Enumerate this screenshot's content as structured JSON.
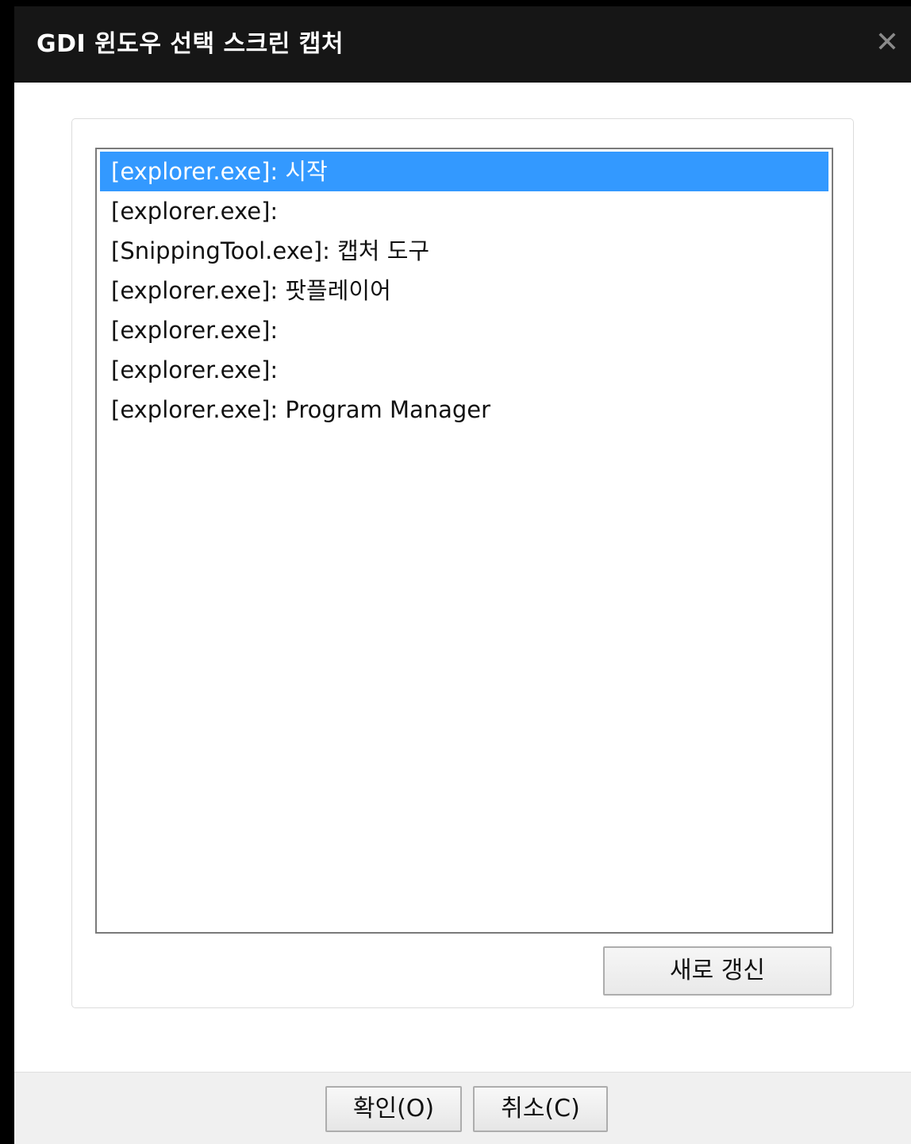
{
  "window": {
    "title": "GDI 윈도우 선택 스크린 캡처",
    "close_symbol": "✕"
  },
  "window_list": {
    "items": [
      {
        "label": "[explorer.exe]: 시작",
        "selected": true
      },
      {
        "label": "[explorer.exe]:",
        "selected": false
      },
      {
        "label": "[SnippingTool.exe]: 캡처 도구",
        "selected": false
      },
      {
        "label": "[explorer.exe]: 팟플레이어",
        "selected": false
      },
      {
        "label": "[explorer.exe]:",
        "selected": false
      },
      {
        "label": "[explorer.exe]:",
        "selected": false
      },
      {
        "label": "[explorer.exe]: Program Manager",
        "selected": false
      }
    ]
  },
  "buttons": {
    "refresh": "새로 갱신",
    "ok": "확인(O)",
    "cancel": "취소(C)"
  },
  "colors": {
    "titlebar_bg": "#161616",
    "selection": "#3399ff",
    "footer_bg": "#f0f0f0"
  }
}
